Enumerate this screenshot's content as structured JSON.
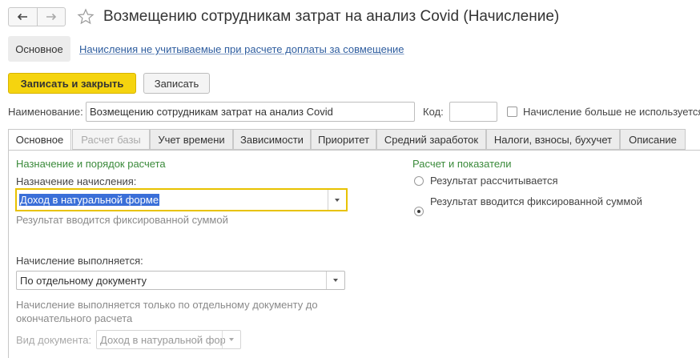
{
  "header": {
    "back_icon": "arrow-left-icon",
    "forward_icon": "arrow-right-icon",
    "favorite_icon": "star-icon",
    "title": "Возмещению сотрудникам затрат на анализ Covid (Начисление)"
  },
  "sections": {
    "main": "Основное",
    "link": "Начисления не учитываемые при расчете доплаты за совмещение"
  },
  "toolbar": {
    "save_close": "Записать и закрыть",
    "save": "Записать"
  },
  "form": {
    "name_label": "Наименование:",
    "name_value": "Возмещению сотрудникам затрат на анализ Covid",
    "code_label": "Код:",
    "code_value": "",
    "not_used_label": "Начисление больше не используется"
  },
  "tabs": [
    {
      "label": "Основное"
    },
    {
      "label": "Расчет базы"
    },
    {
      "label": "Учет времени"
    },
    {
      "label": "Зависимости"
    },
    {
      "label": "Приоритет"
    },
    {
      "label": "Средний заработок"
    },
    {
      "label": "Налоги, взносы, бухучет"
    },
    {
      "label": "Описание"
    }
  ],
  "main_tab": {
    "purpose_group": "Назначение и порядок расчета",
    "purpose_label": "Назначение начисления:",
    "purpose_value": "Доход в натуральной форме",
    "purpose_hint": "Результат вводится фиксированной суммой",
    "exec_label": "Начисление выполняется:",
    "exec_value": "По отдельному документу",
    "exec_hint": "Начисление выполняется только по отдельному документу до окончательного расчета",
    "doc_label": "Вид документа:",
    "doc_value": "Доход в натуральной фор",
    "calc_group": "Расчет и показатели",
    "radio_calc": "Результат рассчитывается",
    "radio_fixed": "Результат вводится фиксированной суммой",
    "selected_radio": "radio_fixed"
  },
  "colors": {
    "accent_yellow": "#f5d40f",
    "group_green": "#3a8a3a",
    "link_blue": "#2e5d9f",
    "focus_border": "#e8c200",
    "selection": "#3a6fd8"
  }
}
